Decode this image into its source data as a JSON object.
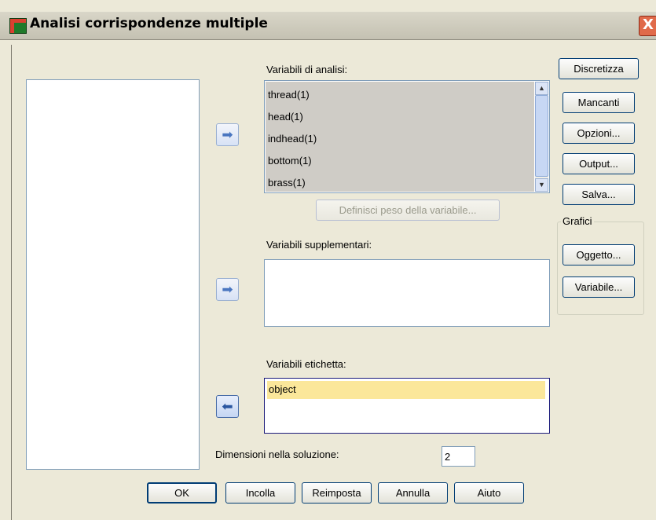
{
  "window": {
    "title": "Analisi corrispondenze multiple",
    "close_glyph": "X"
  },
  "analysis": {
    "label": "Variabili di analisi:",
    "items": [
      "thread(1)",
      "head(1)",
      "indhead(1)",
      "bottom(1)",
      "brass(1)"
    ],
    "weight_button": "Definisci peso della variabile..."
  },
  "supplementary": {
    "label": "Variabili supplementari:"
  },
  "labeling": {
    "label": "Variabili etichetta:",
    "items": [
      "object"
    ]
  },
  "dimensions": {
    "label": "Dimensioni nella soluzione:",
    "value": "2"
  },
  "side_buttons": {
    "discretize": "Discretizza",
    "missing": "Mancanti",
    "options": "Opzioni...",
    "output": "Output...",
    "save": "Salva..."
  },
  "plots": {
    "legend": "Grafici",
    "object": "Oggetto...",
    "variable": "Variabile..."
  },
  "footer": {
    "ok": "OK",
    "paste": "Incolla",
    "reset": "Reimposta",
    "cancel": "Annulla",
    "help": "Aiuto"
  },
  "icons": {
    "arrow_right": "➡",
    "arrow_left": "⬅",
    "scroll_up": "▲",
    "scroll_down": "▼"
  }
}
